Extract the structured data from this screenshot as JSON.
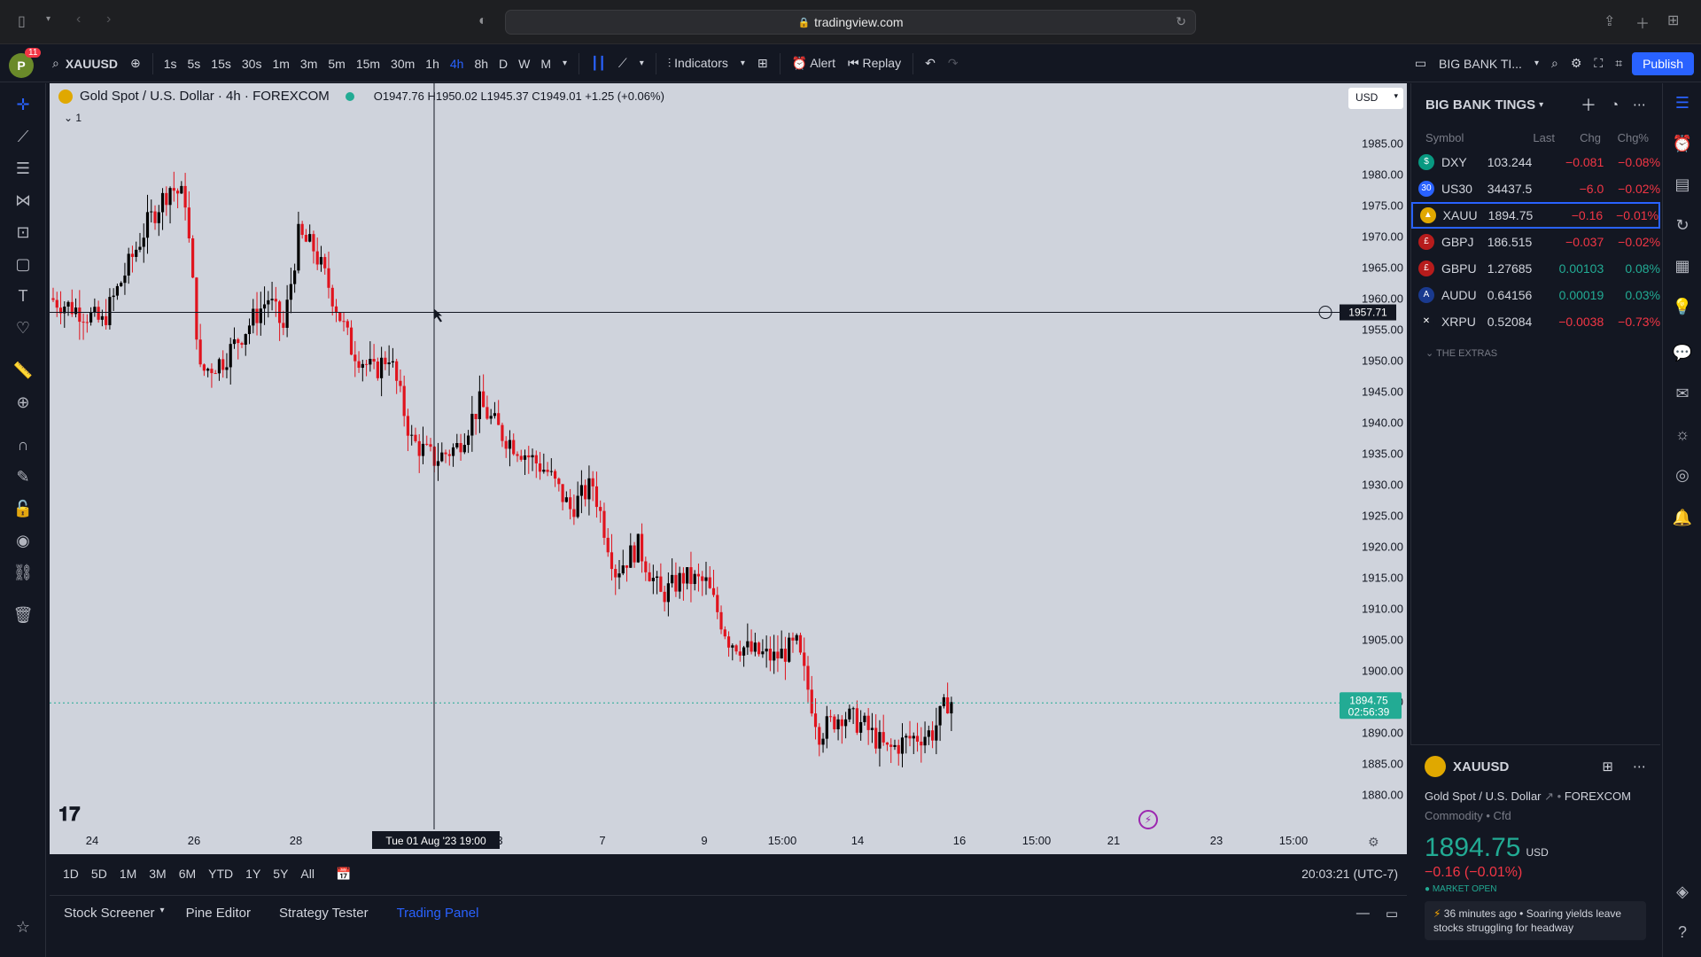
{
  "browser": {
    "url": "tradingview.com"
  },
  "toolbar": {
    "notification_count": "11",
    "avatar_letter": "P",
    "symbol": "XAUUSD",
    "intervals": [
      "1s",
      "5s",
      "15s",
      "30s",
      "1m",
      "3m",
      "5m",
      "15m",
      "30m",
      "1h",
      "4h",
      "8h",
      "D",
      "W",
      "M"
    ],
    "active_interval": "4h",
    "indicators_label": "Indicators",
    "alert_label": "Alert",
    "replay_label": "Replay",
    "layout_name": "BIG BANK TI...",
    "publish_label": "Publish"
  },
  "chart": {
    "title": "Gold Spot / U.S. Dollar · 4h · FOREXCOM",
    "ohlc": "O1947.76 H1950.02 L1945.37 C1949.01 +1.25 (+0.06%)",
    "collapse_count": "1",
    "currency": "USD",
    "price_axis": [
      "1985.00",
      "1980.00",
      "1975.00",
      "1970.00",
      "1965.00",
      "1960.00",
      "1955.00",
      "1950.00",
      "1945.00",
      "1940.00",
      "1935.00",
      "1930.00",
      "1925.00",
      "1920.00",
      "1915.00",
      "1910.00",
      "1905.00",
      "1900.00",
      "1895.00",
      "1890.00",
      "1885.00",
      "1880.00"
    ],
    "time_axis": [
      "24",
      "26",
      "28",
      "3",
      "7",
      "9",
      "15:00",
      "14",
      "16",
      "15:00",
      "21",
      "23",
      "15:00"
    ],
    "crosshair_price": "1957.71",
    "crosshair_time": "Tue 01 Aug '23   19:00",
    "last_price": "1894.75",
    "countdown": "02:56:39",
    "colors": {
      "up": "#000000",
      "down": "#e0141e",
      "background": "#cfd3dc"
    }
  },
  "rangebar": {
    "ranges": [
      "1D",
      "5D",
      "1M",
      "3M",
      "6M",
      "YTD",
      "1Y",
      "5Y",
      "All"
    ],
    "clock": "20:03:21 (UTC-7)"
  },
  "bottom_tabs": {
    "tabs": [
      "Stock Screener",
      "Pine Editor",
      "Strategy Tester",
      "Trading Panel"
    ],
    "active": "Trading Panel"
  },
  "watchlist": {
    "title": "BIG BANK TINGS",
    "columns": [
      "Symbol",
      "Last",
      "Chg",
      "Chg%"
    ],
    "rows": [
      {
        "symbol": "DXY",
        "last": "103.244",
        "chg": "−0.081",
        "pct": "−0.08%",
        "dir": "neg",
        "logo": "$",
        "logo_color": "#089981"
      },
      {
        "symbol": "US30",
        "last": "34437.5",
        "chg": "−6.0",
        "pct": "−0.02%",
        "dir": "neg",
        "logo": "30",
        "logo_color": "#2962ff"
      },
      {
        "symbol": "XAUU",
        "last": "1894.75",
        "chg": "−0.16",
        "pct": "−0.01%",
        "dir": "neg",
        "logo": "▲",
        "logo_color": "#e0a800"
      },
      {
        "symbol": "GBPJ",
        "last": "186.515",
        "chg": "−0.037",
        "pct": "−0.02%",
        "dir": "neg",
        "logo": "£",
        "logo_color": "#b71c1c"
      },
      {
        "symbol": "GBPU",
        "last": "1.27685",
        "chg": "0.00103",
        "pct": "0.08%",
        "dir": "pos",
        "logo": "£",
        "logo_color": "#b71c1c"
      },
      {
        "symbol": "AUDU",
        "last": "0.64156",
        "chg": "0.00019",
        "pct": "0.03%",
        "dir": "pos",
        "logo": "A",
        "logo_color": "#1a3a8f"
      },
      {
        "symbol": "XRPU",
        "last": "0.52084",
        "chg": "−0.0038",
        "pct": "−0.73%",
        "dir": "neg",
        "logo": "✕",
        "logo_color": "#131722"
      }
    ],
    "section": "THE EXTRAS"
  },
  "details": {
    "symbol": "XAUUSD",
    "name": "Gold Spot / U.S. Dollar",
    "exchange": "FOREXCOM",
    "category": "Commodity • Cfd",
    "price": "1894.75",
    "price_unit": "USD",
    "change": "−0.16 (−0.01%)",
    "market_status": "MARKET OPEN",
    "news": "36 minutes ago • Soaring yields leave stocks struggling for headway"
  }
}
